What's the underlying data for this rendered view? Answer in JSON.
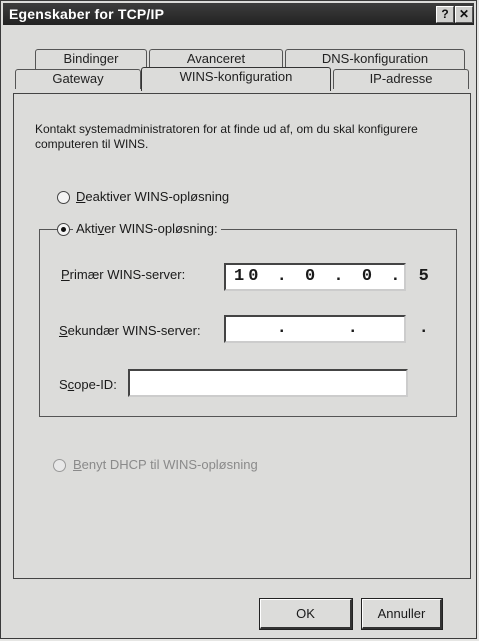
{
  "window": {
    "title": "Egenskaber for TCP/IP"
  },
  "titlebar": {
    "help_glyph": "?",
    "close_glyph": "✕"
  },
  "tabs_row1": [
    {
      "label": "Bindinger"
    },
    {
      "label": "Avanceret"
    },
    {
      "label": "DNS-konfiguration"
    }
  ],
  "tabs_row2": [
    {
      "label": "Gateway"
    },
    {
      "label": "WINS-konfiguration",
      "active": true
    },
    {
      "label": "IP-adresse"
    }
  ],
  "info_text": "Kontakt systemadministratoren for at finde ud af, om du skal konfigurere computeren til WINS.",
  "options": {
    "disable": {
      "label_underlined": "D",
      "label_rest": "eaktiver WINS-opløsning",
      "selected": false
    },
    "enable": {
      "label_before": "Akti",
      "label_underlined": "v",
      "label_rest": "er WINS-opløsning:",
      "selected": true
    },
    "dhcp": {
      "label_before": "",
      "label_underlined": "B",
      "label_rest": "enyt DHCP til WINS-opløsning",
      "enabled": false
    }
  },
  "fields": {
    "primary": {
      "label_underlined": "P",
      "label_rest": "rimær WINS-server:",
      "value": "10 . 0 . 0 . 5"
    },
    "secondary": {
      "label_underlined": "S",
      "label_rest": "ekundær WINS-server:",
      "value": "   .    .    ."
    },
    "scope": {
      "label_before": "S",
      "label_underlined": "c",
      "label_rest": "ope-ID:",
      "value": ""
    }
  },
  "buttons": {
    "ok": "OK",
    "cancel": "Annuller"
  },
  "colors": {
    "titlebar": "#2a2a2a",
    "dialog": "#dcdcda",
    "field": "#ffffff"
  }
}
